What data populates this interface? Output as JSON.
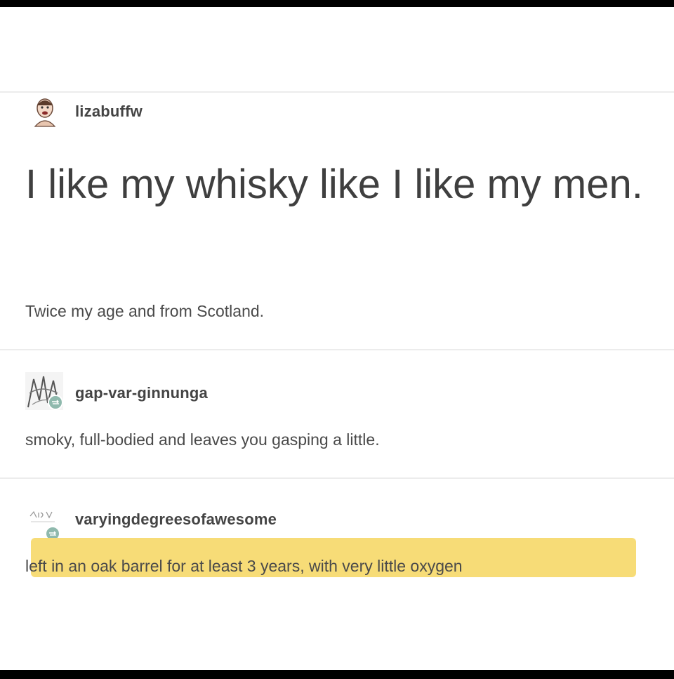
{
  "posts": [
    {
      "username": "lizabuffw",
      "title": "I like my whisky like I like my men.",
      "body": "Twice my age and from Scotland."
    },
    {
      "username": "gap-var-ginnunga",
      "body": "smoky, full-bodied and leaves you gasping a little."
    },
    {
      "username": "varyingdegreesofawesome",
      "body": "left in an oak barrel for at least 3 years, with very little oxygen"
    }
  ],
  "colors": {
    "highlight": "#f7dc77",
    "reblog_badge": "#8fb9ad",
    "text": "#444444"
  }
}
